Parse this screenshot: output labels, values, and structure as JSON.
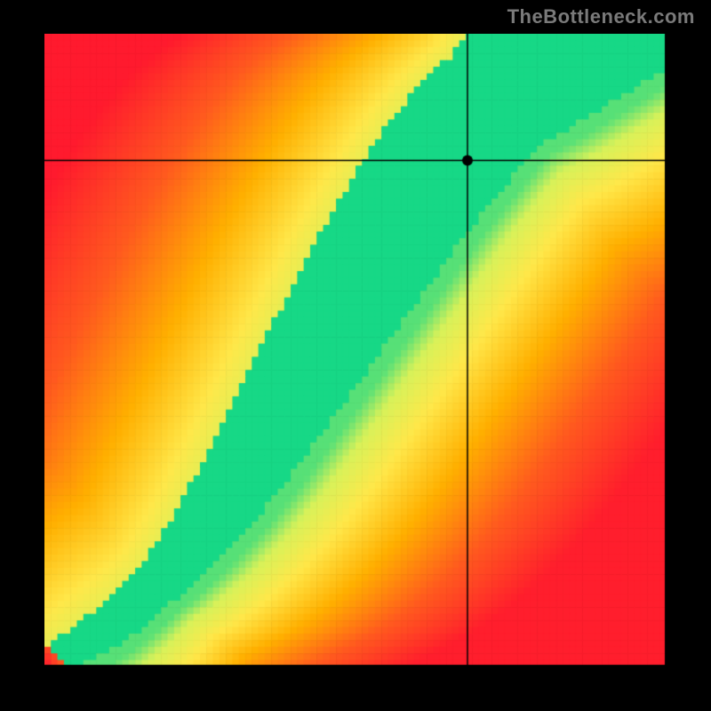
{
  "watermark": "TheBottleneck.com",
  "chart_data": {
    "type": "heatmap",
    "title": "",
    "xlabel": "",
    "ylabel": "",
    "xlim": [
      0,
      1
    ],
    "ylim": [
      0,
      1
    ],
    "crosshair": {
      "x": 0.68,
      "y": 0.8
    },
    "marker": {
      "x": 0.68,
      "y": 0.8
    },
    "ridge": {
      "description": "Green optimal band along a curved diagonal; value decays to yellow/orange/red with distance from ridge.",
      "points": [
        {
          "x": 0.0,
          "y": 0.0
        },
        {
          "x": 0.05,
          "y": 0.03
        },
        {
          "x": 0.1,
          "y": 0.06
        },
        {
          "x": 0.15,
          "y": 0.1
        },
        {
          "x": 0.2,
          "y": 0.15
        },
        {
          "x": 0.25,
          "y": 0.21
        },
        {
          "x": 0.3,
          "y": 0.28
        },
        {
          "x": 0.35,
          "y": 0.36
        },
        {
          "x": 0.4,
          "y": 0.44
        },
        {
          "x": 0.45,
          "y": 0.52
        },
        {
          "x": 0.5,
          "y": 0.6
        },
        {
          "x": 0.55,
          "y": 0.68
        },
        {
          "x": 0.6,
          "y": 0.75
        },
        {
          "x": 0.65,
          "y": 0.82
        },
        {
          "x": 0.7,
          "y": 0.88
        },
        {
          "x": 0.75,
          "y": 0.93
        },
        {
          "x": 0.8,
          "y": 0.97
        },
        {
          "x": 0.85,
          "y": 1.0
        }
      ],
      "half_width_start": 0.005,
      "half_width_end": 0.11
    },
    "colorscale": [
      {
        "t": 0.0,
        "color": "#ff1a2e"
      },
      {
        "t": 0.3,
        "color": "#ff5a1f"
      },
      {
        "t": 0.55,
        "color": "#ffb000"
      },
      {
        "t": 0.75,
        "color": "#ffe84a"
      },
      {
        "t": 0.88,
        "color": "#d8f25a"
      },
      {
        "t": 1.0,
        "color": "#17d886"
      }
    ],
    "pixelation": 96
  }
}
